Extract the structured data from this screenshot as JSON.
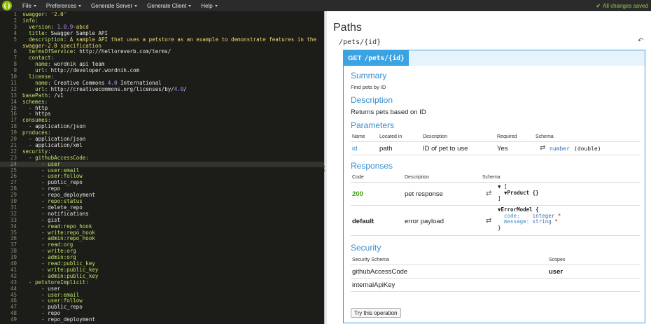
{
  "topbar": {
    "logo": "{}",
    "menu": [
      {
        "label": "File"
      },
      {
        "label": "Preferences"
      },
      {
        "label": "Generate Server"
      },
      {
        "label": "Generate Client"
      },
      {
        "label": "Help"
      }
    ],
    "status": "All changes saved",
    "colors": {
      "bar": "#2b2b2b",
      "status": "#8fce45",
      "logo": "#89bf04"
    }
  },
  "editor": {
    "active_line": 24,
    "lines": [
      {
        "n": "1",
        "parts": [
          [
            "k",
            "swagger"
          ],
          [
            "p",
            ": "
          ],
          [
            "s",
            "'2.0'"
          ]
        ]
      },
      {
        "n": "2",
        "parts": [
          [
            "k",
            "info"
          ],
          [
            "p",
            ":"
          ]
        ]
      },
      {
        "n": "3",
        "parts": [
          [
            "p",
            "  "
          ],
          [
            "k",
            "version"
          ],
          [
            "p",
            ": "
          ],
          [
            "n",
            "1.0.9"
          ],
          [
            "s",
            "-abcd"
          ]
        ]
      },
      {
        "n": "4",
        "parts": [
          [
            "p",
            "  "
          ],
          [
            "k",
            "title"
          ],
          [
            "p",
            ": "
          ],
          [
            "v",
            "Swagger Sample API"
          ]
        ]
      },
      {
        "n": "5",
        "parts": [
          [
            "p",
            "  "
          ],
          [
            "k",
            "description"
          ],
          [
            "p",
            ": "
          ],
          [
            "s",
            "A sample API that uses a petstore as an example to demonstrate features in the"
          ]
        ]
      },
      {
        "n": "",
        "parts": [
          [
            "s",
            "swagger-2.0 specification"
          ]
        ]
      },
      {
        "n": "6",
        "parts": [
          [
            "p",
            "  "
          ],
          [
            "k",
            "termsOfService"
          ],
          [
            "p",
            ": "
          ],
          [
            "v",
            "http://helloreverb.com/terms/"
          ]
        ]
      },
      {
        "n": "7",
        "parts": [
          [
            "p",
            "  "
          ],
          [
            "k",
            "contact"
          ],
          [
            "p",
            ":"
          ]
        ]
      },
      {
        "n": "8",
        "parts": [
          [
            "p",
            "    "
          ],
          [
            "k",
            "name"
          ],
          [
            "p",
            ": "
          ],
          [
            "v",
            "wordnik api team"
          ]
        ]
      },
      {
        "n": "9",
        "parts": [
          [
            "p",
            "    "
          ],
          [
            "k",
            "url"
          ],
          [
            "p",
            ": "
          ],
          [
            "v",
            "http://developer.wordnik.com"
          ]
        ]
      },
      {
        "n": "10",
        "parts": [
          [
            "p",
            "  "
          ],
          [
            "k",
            "license"
          ],
          [
            "p",
            ":"
          ]
        ]
      },
      {
        "n": "11",
        "parts": [
          [
            "p",
            "    "
          ],
          [
            "k",
            "name"
          ],
          [
            "p",
            ": "
          ],
          [
            "v",
            "Creative Commons "
          ],
          [
            "n",
            "4.0"
          ],
          [
            "v",
            " International"
          ]
        ]
      },
      {
        "n": "12",
        "parts": [
          [
            "p",
            "    "
          ],
          [
            "k",
            "url"
          ],
          [
            "p",
            ": "
          ],
          [
            "v",
            "http://creativecommons.org/licenses/by/"
          ],
          [
            "n",
            "4.0"
          ],
          [
            "v",
            "/"
          ]
        ]
      },
      {
        "n": "13",
        "parts": [
          [
            "k",
            "basePath"
          ],
          [
            "p",
            ": "
          ],
          [
            "v",
            "/v1"
          ]
        ]
      },
      {
        "n": "14",
        "parts": [
          [
            "k",
            "schemes"
          ],
          [
            "p",
            ":"
          ]
        ]
      },
      {
        "n": "15",
        "parts": [
          [
            "p",
            "  - "
          ],
          [
            "v",
            "http"
          ]
        ]
      },
      {
        "n": "16",
        "parts": [
          [
            "p",
            "  - "
          ],
          [
            "v",
            "https"
          ]
        ]
      },
      {
        "n": "17",
        "parts": [
          [
            "k",
            "consumes"
          ],
          [
            "p",
            ":"
          ]
        ]
      },
      {
        "n": "18",
        "parts": [
          [
            "p",
            "  - "
          ],
          [
            "v",
            "application/json"
          ]
        ]
      },
      {
        "n": "19",
        "parts": [
          [
            "k",
            "produces"
          ],
          [
            "p",
            ":"
          ]
        ]
      },
      {
        "n": "20",
        "parts": [
          [
            "p",
            "  - "
          ],
          [
            "v",
            "application/json"
          ]
        ]
      },
      {
        "n": "21",
        "parts": [
          [
            "p",
            "  - "
          ],
          [
            "v",
            "application/xml"
          ]
        ]
      },
      {
        "n": "22",
        "parts": [
          [
            "k",
            "security"
          ],
          [
            "p",
            ":"
          ]
        ]
      },
      {
        "n": "23",
        "parts": [
          [
            "p",
            "  - "
          ],
          [
            "k",
            "githubAccessCode"
          ],
          [
            "p",
            ":"
          ]
        ]
      },
      {
        "n": "24",
        "parts": [
          [
            "p",
            "      - "
          ],
          [
            "k",
            "user"
          ]
        ]
      },
      {
        "n": "25",
        "parts": [
          [
            "p",
            "      - "
          ],
          [
            "k",
            "user:email"
          ]
        ]
      },
      {
        "n": "26",
        "parts": [
          [
            "p",
            "      - "
          ],
          [
            "k",
            "user:follow"
          ]
        ]
      },
      {
        "n": "27",
        "parts": [
          [
            "p",
            "      - "
          ],
          [
            "v",
            "public_repo"
          ]
        ]
      },
      {
        "n": "28",
        "parts": [
          [
            "p",
            "      - "
          ],
          [
            "v",
            "repo"
          ]
        ]
      },
      {
        "n": "29",
        "parts": [
          [
            "p",
            "      - "
          ],
          [
            "v",
            "repo_deployment"
          ]
        ]
      },
      {
        "n": "30",
        "parts": [
          [
            "p",
            "      - "
          ],
          [
            "k",
            "repo:status"
          ]
        ]
      },
      {
        "n": "31",
        "parts": [
          [
            "p",
            "      - "
          ],
          [
            "v",
            "delete_repo"
          ]
        ]
      },
      {
        "n": "32",
        "parts": [
          [
            "p",
            "      - "
          ],
          [
            "v",
            "notifications"
          ]
        ]
      },
      {
        "n": "33",
        "parts": [
          [
            "p",
            "      - "
          ],
          [
            "v",
            "gist"
          ]
        ]
      },
      {
        "n": "34",
        "parts": [
          [
            "p",
            "      - "
          ],
          [
            "k",
            "read:repo_hook"
          ]
        ]
      },
      {
        "n": "35",
        "parts": [
          [
            "p",
            "      - "
          ],
          [
            "k",
            "write:repo_hook"
          ]
        ]
      },
      {
        "n": "36",
        "parts": [
          [
            "p",
            "      - "
          ],
          [
            "k",
            "admin:repo_hook"
          ]
        ]
      },
      {
        "n": "37",
        "parts": [
          [
            "p",
            "      - "
          ],
          [
            "k",
            "read:org"
          ]
        ]
      },
      {
        "n": "38",
        "parts": [
          [
            "p",
            "      - "
          ],
          [
            "k",
            "write:org"
          ]
        ]
      },
      {
        "n": "39",
        "parts": [
          [
            "p",
            "      - "
          ],
          [
            "k",
            "admin:org"
          ]
        ]
      },
      {
        "n": "40",
        "parts": [
          [
            "p",
            "      - "
          ],
          [
            "k",
            "read:public_key"
          ]
        ]
      },
      {
        "n": "41",
        "parts": [
          [
            "p",
            "      - "
          ],
          [
            "k",
            "write:public_key"
          ]
        ]
      },
      {
        "n": "42",
        "parts": [
          [
            "p",
            "      - "
          ],
          [
            "k",
            "admin:public_key"
          ]
        ]
      },
      {
        "n": "43",
        "parts": [
          [
            "p",
            "  - "
          ],
          [
            "k",
            "petstoreImplicit"
          ],
          [
            "p",
            ":"
          ]
        ]
      },
      {
        "n": "44",
        "parts": [
          [
            "p",
            "      - "
          ],
          [
            "v",
            "user"
          ]
        ]
      },
      {
        "n": "45",
        "parts": [
          [
            "p",
            "      - "
          ],
          [
            "k",
            "user:email"
          ]
        ]
      },
      {
        "n": "46",
        "parts": [
          [
            "p",
            "      - "
          ],
          [
            "k",
            "user:follow"
          ]
        ]
      },
      {
        "n": "47",
        "parts": [
          [
            "p",
            "      - "
          ],
          [
            "v",
            "public_repo"
          ]
        ]
      },
      {
        "n": "48",
        "parts": [
          [
            "p",
            "      - "
          ],
          [
            "v",
            "repo"
          ]
        ]
      },
      {
        "n": "49",
        "parts": [
          [
            "p",
            "      - "
          ],
          [
            "v",
            "repo_deployment"
          ]
        ]
      }
    ]
  },
  "preview": {
    "title": "Paths",
    "path": "/pets/{id}",
    "operation": {
      "method": "GET",
      "path": "/pets/{id}",
      "summary_heading": "Summary",
      "summary": "Find pets by ID",
      "description_heading": "Description",
      "description": "Returns pets based on ID",
      "parameters_heading": "Parameters",
      "param_headers": {
        "name": "Name",
        "located": "Located in",
        "description": "Description",
        "required": "Required",
        "schema": "Schema"
      },
      "param": {
        "name": "id",
        "located": "path",
        "description": "ID of pet to use",
        "required": "Yes",
        "schema_type": "number",
        "schema_format": "(double)"
      },
      "responses_heading": "Responses",
      "resp_headers": {
        "code": "Code",
        "description": "Description",
        "schema": "Schema"
      },
      "responses": [
        {
          "code": "200",
          "description": "pet response"
        },
        {
          "code": "default",
          "description": "error payload"
        }
      ],
      "product_schema": {
        "open": "▼ [",
        "inner": "▼Product {}",
        "close": "]"
      },
      "error_schema": {
        "name": "▼ErrorModel {",
        "f1": "code:",
        "t1": "integer",
        "f2": "message:",
        "t2": "string",
        "req": "*",
        "close": "}"
      },
      "security_heading": "Security",
      "sec_headers": {
        "schema": "Security Schema",
        "scopes": "Scopes"
      },
      "security": [
        {
          "schema": "githubAccessCode",
          "scope": "user"
        },
        {
          "schema": "internalApiKey",
          "scope": ""
        }
      ],
      "try_label": "Try this operation"
    },
    "colors": {
      "accent": "#3aa3e3",
      "code_ok": "#41a00d"
    }
  }
}
